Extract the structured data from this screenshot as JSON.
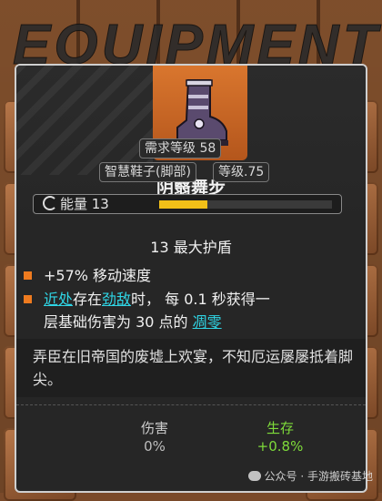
{
  "background": {
    "title": "EQUIPMENT"
  },
  "item": {
    "name": "阴翳舞步",
    "icon": "boot-icon",
    "required_level": "需求等级 58",
    "type": "智慧鞋子(脚部)",
    "level": "等级.75",
    "energy_label": "能量 13",
    "energy_fraction": 0.28,
    "max_shield": "13 最大护盾"
  },
  "stats": {
    "stat1": "+57% 移动速度",
    "stat2": {
      "kw_near": "近处",
      "t1": "存在",
      "kw_enemy": "劲敌",
      "t2": "时， 每 0.1 秒获得一",
      "t3": "层基础伤害为 30 点的 ",
      "kw_wither": "凋零"
    }
  },
  "flavor": "弄臣在旧帝国的废墟上欢宴，不知厄运屡屡抵着脚尖。",
  "compare": {
    "damage_label": "伤害",
    "damage_value": "0%",
    "survive_label": "生存",
    "survive_value": "+0.8%"
  },
  "colors": {
    "keyword": "#2fd6e6",
    "bullet": "#ef7b1f",
    "positive": "#7edb3a",
    "icon_bg": "#d9762e",
    "energy": "#f2c018"
  },
  "watermark": "公众号 · 手游搬砖基地"
}
